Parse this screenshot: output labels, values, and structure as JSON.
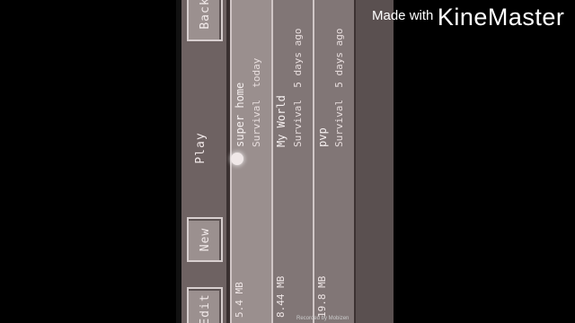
{
  "watermark": {
    "prefix": "Made with",
    "brand": "KineMaster"
  },
  "recorded_note": "Recorded by Mobizen",
  "toolbar": {
    "back_label": "Back",
    "play_label": "Play",
    "new_label": "New",
    "edit_label": "Edit"
  },
  "worlds": [
    {
      "name": "super home",
      "mode": "Survival",
      "when": "today",
      "size": "5.4 MB",
      "selected": true
    },
    {
      "name": "My World",
      "mode": "Survival",
      "when": "5 days ago",
      "size": "8.44 MB",
      "selected": false
    },
    {
      "name": "pvp",
      "mode": "Survival",
      "when": "5 days ago",
      "size": "19.8 MB",
      "selected": false
    }
  ]
}
